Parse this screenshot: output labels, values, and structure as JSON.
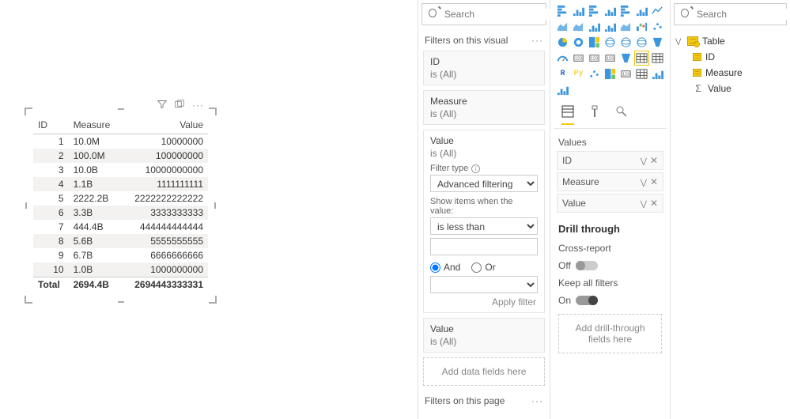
{
  "search": {
    "placeholder": "Search"
  },
  "table_visual": {
    "headers": [
      "ID",
      "Measure",
      "Value"
    ],
    "rows": [
      {
        "id": "1",
        "measure": "10.0M",
        "value": "10000000"
      },
      {
        "id": "2",
        "measure": "100.0M",
        "value": "100000000"
      },
      {
        "id": "3",
        "measure": "10.0B",
        "value": "10000000000"
      },
      {
        "id": "4",
        "measure": "1.1B",
        "value": "1111111111"
      },
      {
        "id": "5",
        "measure": "2222.2B",
        "value": "2222222222222"
      },
      {
        "id": "6",
        "measure": "3.3B",
        "value": "3333333333"
      },
      {
        "id": "7",
        "measure": "444.4B",
        "value": "444444444444"
      },
      {
        "id": "8",
        "measure": "5.6B",
        "value": "5555555555"
      },
      {
        "id": "9",
        "measure": "6.7B",
        "value": "6666666666"
      },
      {
        "id": "10",
        "measure": "1.0B",
        "value": "1000000000"
      }
    ],
    "total_label": "Total",
    "total_measure": "2694.4B",
    "total_value": "2694443333331"
  },
  "filters": {
    "on_visual_label": "Filters on this visual",
    "on_page_label": "Filters on this page",
    "is_all": "is (All)",
    "cards": [
      "ID",
      "Measure",
      "Value"
    ],
    "expanded": {
      "name": "Value",
      "filter_type_label": "Filter type",
      "filter_type_value": "Advanced filtering",
      "show_items_label": "Show items when the value:",
      "op_value": "is less than",
      "and_label": "And",
      "or_label": "Or",
      "apply_label": "Apply filter"
    },
    "second_value_card": "Value",
    "add_fields_label": "Add data fields here"
  },
  "viz": {
    "values_label": "Values",
    "wells": [
      "ID",
      "Measure",
      "Value"
    ],
    "drill_title": "Drill through",
    "cross_report_label": "Cross-report",
    "cross_report_state": "Off",
    "keep_filters_label": "Keep all filters",
    "keep_filters_state": "On",
    "add_drill_label": "Add drill-through fields here",
    "gallery": [
      "stacked-bar",
      "stacked-column",
      "clustered-bar",
      "clustered-column",
      "100-stacked-bar",
      "100-stacked-column",
      "line",
      "area",
      "stacked-area",
      "line-stacked-column",
      "line-clustered-column",
      "ribbon",
      "waterfall",
      "scatter",
      "pie",
      "donut",
      "treemap",
      "map",
      "filled-map",
      "shape-map",
      "funnel",
      "gauge",
      "card",
      "multi-row-card",
      "kpi",
      "slicer",
      "table",
      "matrix",
      "r-visual",
      "python-visual",
      "key-influencers",
      "decomposition-tree",
      "qna",
      "paginated",
      "custom1",
      "import-visual",
      "",
      "",
      "",
      "",
      "",
      ""
    ]
  },
  "fields": {
    "table_name": "Table",
    "columns": [
      {
        "name": "ID",
        "icon": "table"
      },
      {
        "name": "Measure",
        "icon": "table"
      },
      {
        "name": "Value",
        "icon": "sigma"
      }
    ]
  }
}
